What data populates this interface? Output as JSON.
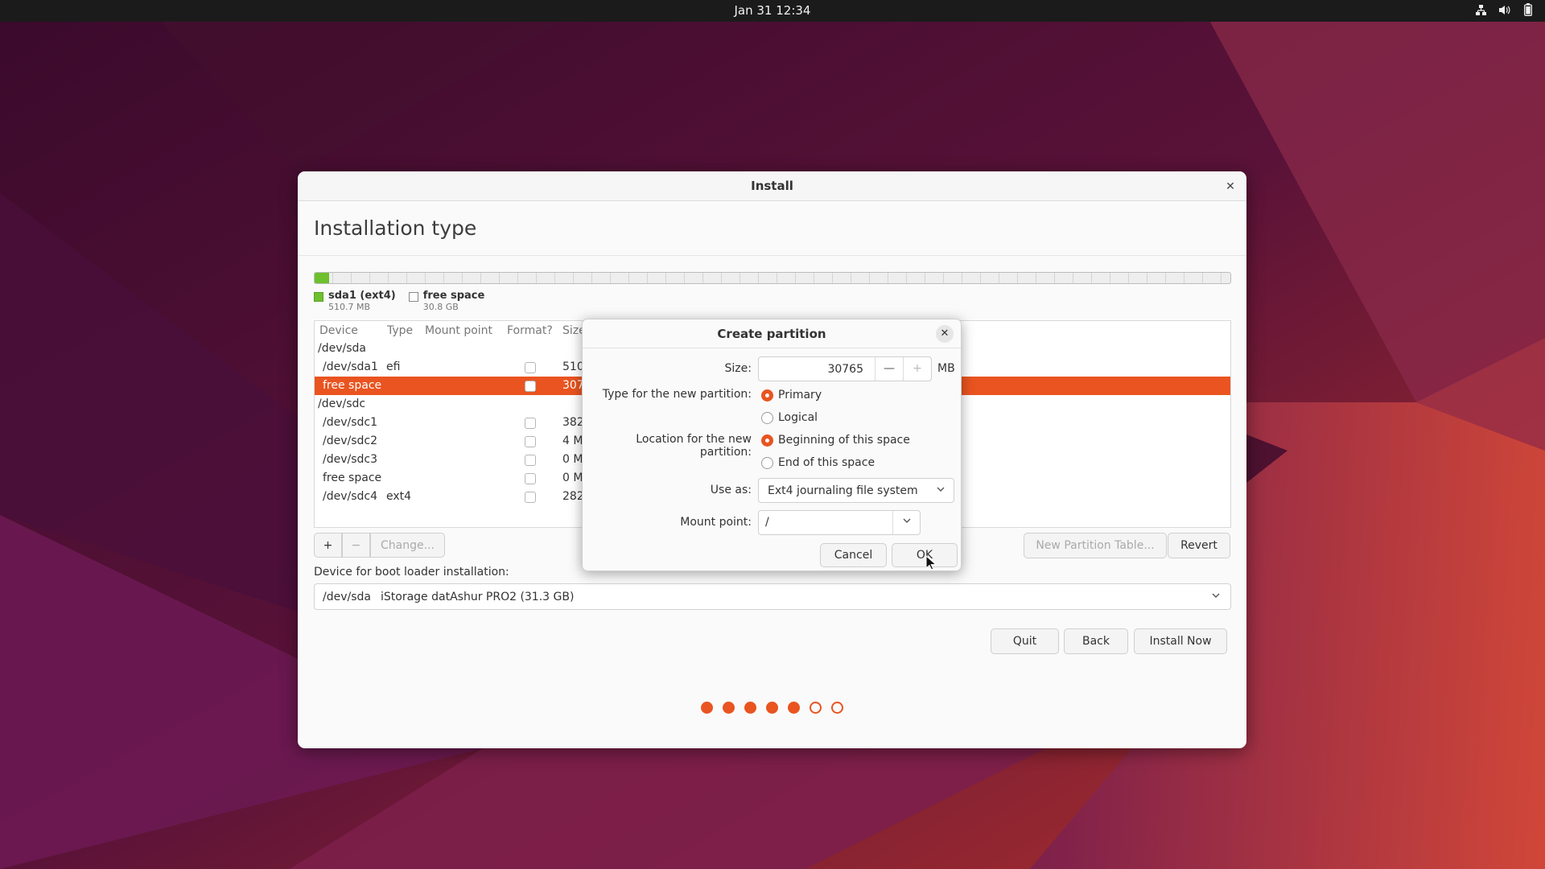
{
  "topbar": {
    "clock": "Jan 31  12:34",
    "tray_icons": [
      "network-icon",
      "volume-icon",
      "battery-icon"
    ]
  },
  "window": {
    "title": "Install",
    "page_title": "Installation type"
  },
  "legend": [
    {
      "name": "sda1 (ext4)",
      "size": "510.7 MB",
      "color": "#6ec02f"
    },
    {
      "name": "free space",
      "size": "30.8 GB",
      "color": "#ffffff"
    }
  ],
  "table": {
    "headers": [
      "Device",
      "Type",
      "Mount point",
      "Format?",
      "Size"
    ],
    "rows": [
      {
        "device": "/dev/sda",
        "type": "",
        "size": "",
        "checkbox": false
      },
      {
        "device": "/dev/sda1",
        "type": "efi",
        "size": "510",
        "checkbox": true
      },
      {
        "device": "free space",
        "type": "",
        "size": "307",
        "checkbox": true
      },
      {
        "device": "/dev/sdc",
        "type": "",
        "size": "",
        "checkbox": false
      },
      {
        "device": "/dev/sdc1",
        "type": "",
        "size": "382",
        "checkbox": true
      },
      {
        "device": "/dev/sdc2",
        "type": "",
        "size": "4 M",
        "checkbox": true
      },
      {
        "device": "/dev/sdc3",
        "type": "",
        "size": "0 M",
        "checkbox": true
      },
      {
        "device": "free space",
        "type": "",
        "size": "0 M",
        "checkbox": true
      },
      {
        "device": "/dev/sdc4",
        "type": "ext4",
        "size": "282",
        "checkbox": true
      }
    ]
  },
  "table_buttons": {
    "add": "+",
    "remove": "−",
    "change": "Change...",
    "new_table": "New Partition Table...",
    "revert": "Revert"
  },
  "boot": {
    "label": "Device for boot loader installation:",
    "device": "/dev/sda",
    "description": "iStorage datAshur PRO2 (31.3 GB)"
  },
  "nav": {
    "quit": "Quit",
    "back": "Back",
    "install": "Install Now"
  },
  "progress": {
    "total_steps": 7,
    "completed_steps": 5
  },
  "dialog": {
    "title": "Create partition",
    "size_label": "Size:",
    "size_value": "30765",
    "size_unit": "MB",
    "type_label": "Type for the new partition:",
    "type_primary": "Primary",
    "type_logical": "Logical",
    "location_label": "Location for the new partition:",
    "location_begin": "Beginning of this space",
    "location_end": "End of this space",
    "use_as_label": "Use as:",
    "use_as_value": "Ext4 journaling file system",
    "mount_label": "Mount point:",
    "mount_value": "/",
    "cancel": "Cancel",
    "ok": "OK"
  },
  "colors": {
    "accent": "#e95420",
    "topbar": "#1b1b1b",
    "used_partition": "#6ec02f"
  }
}
